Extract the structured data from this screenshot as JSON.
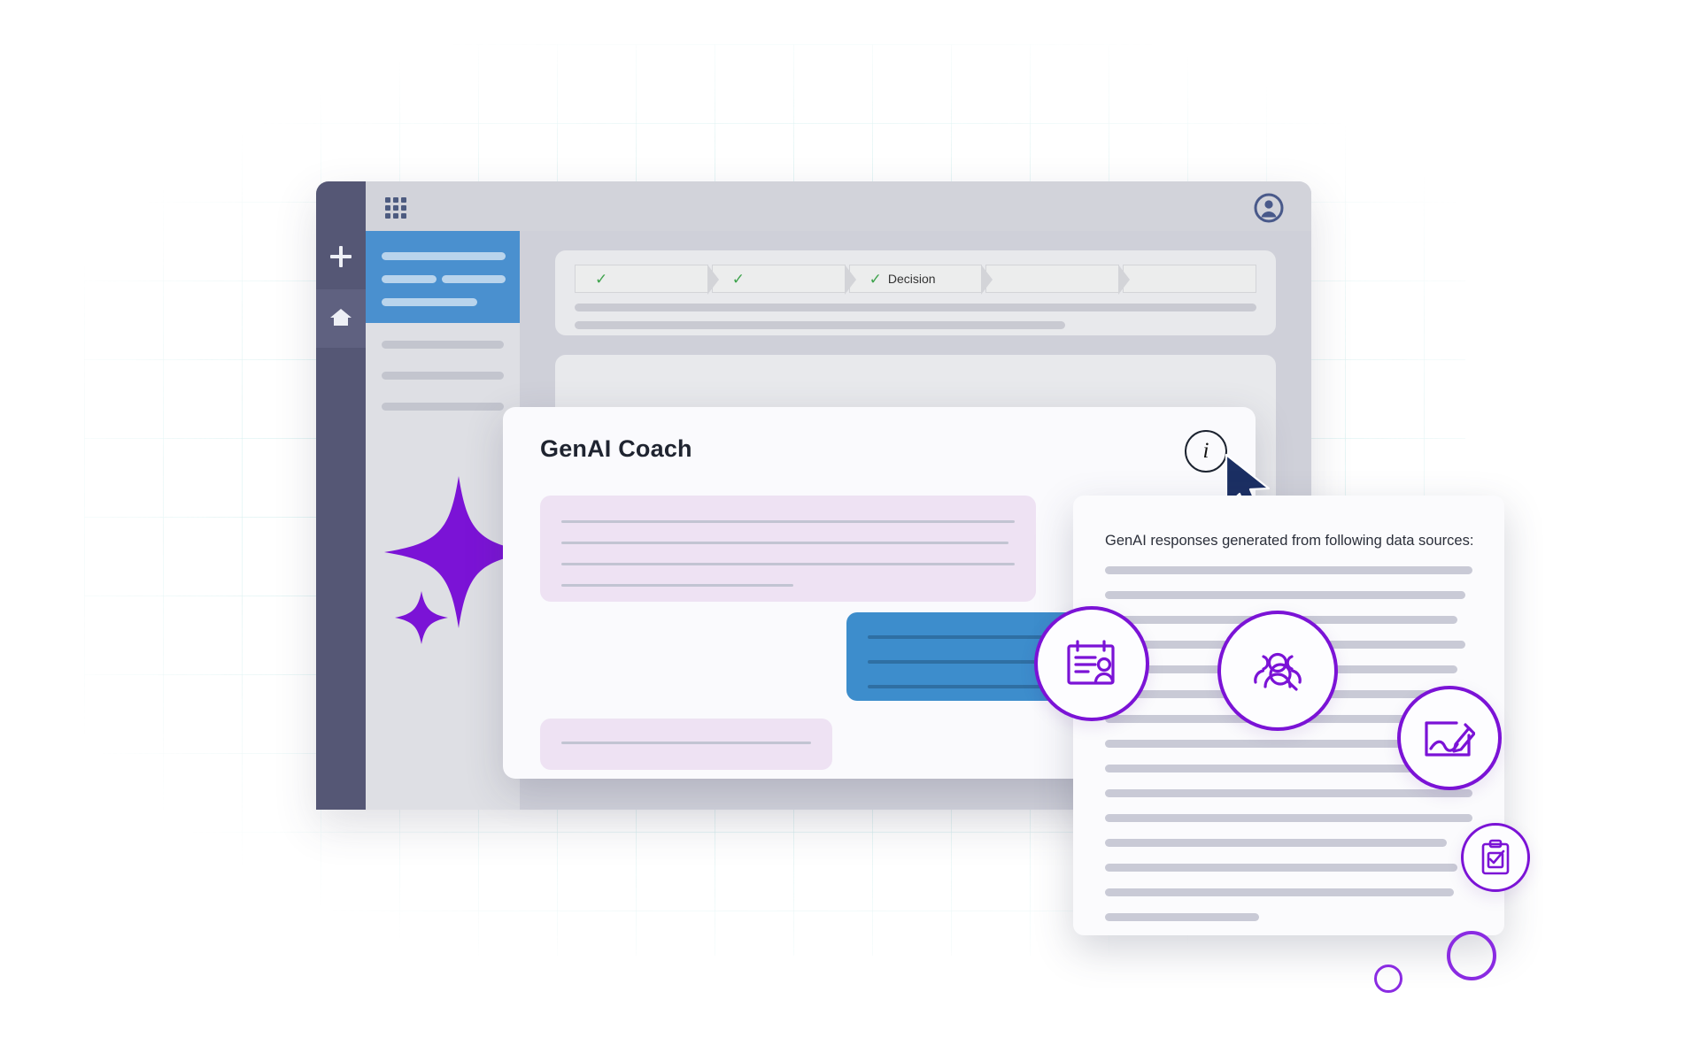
{
  "app": {
    "window_name": "hr-application-window",
    "rail": {
      "add_icon": "plus-icon",
      "home_icon": "home-icon"
    },
    "topbar": {
      "apps_grid_icon": "grid-apps-icon",
      "avatar_icon": "user-avatar-icon"
    },
    "sidebar": {
      "active_item_label": "",
      "items": [
        "",
        "",
        ""
      ]
    },
    "stepper": {
      "steps": [
        {
          "label": "",
          "state": "complete",
          "check": "✓"
        },
        {
          "label": "",
          "state": "complete",
          "check": "✓"
        },
        {
          "label": "Decision",
          "state": "complete",
          "check": "✓"
        },
        {
          "label": "",
          "state": "pending",
          "check": ""
        },
        {
          "label": "",
          "state": "pending",
          "check": ""
        }
      ]
    }
  },
  "coach": {
    "title": "GenAI Coach",
    "info_icon": "info-icon",
    "info_glyph": "i",
    "messages": [
      {
        "role": "assistant",
        "lines": 4
      },
      {
        "role": "user",
        "lines": 3
      },
      {
        "role": "assistant",
        "lines": 1
      }
    ]
  },
  "sources_panel": {
    "title": "GenAI responses generated from following data sources:",
    "line_count": 16,
    "icons": [
      {
        "name": "employee-record-icon",
        "label": "employee record"
      },
      {
        "name": "talent-search-icon",
        "label": "talent search"
      },
      {
        "name": "signature-icon",
        "label": "signature"
      },
      {
        "name": "clipboard-check-icon",
        "label": "clipboard check"
      }
    ]
  },
  "decor": {
    "sparkle_icon": "ai-sparkle-icon",
    "cursor_icon": "mouse-cursor-icon",
    "rings": [
      "decor-ring-large",
      "decor-ring-small"
    ]
  },
  "colors": {
    "purple": "#7b13d6",
    "blue": "#3d8dcc",
    "rail": "#555775",
    "green": "#3fa34d",
    "cursor": "#1b2f63",
    "grid": "#96d7d7"
  }
}
